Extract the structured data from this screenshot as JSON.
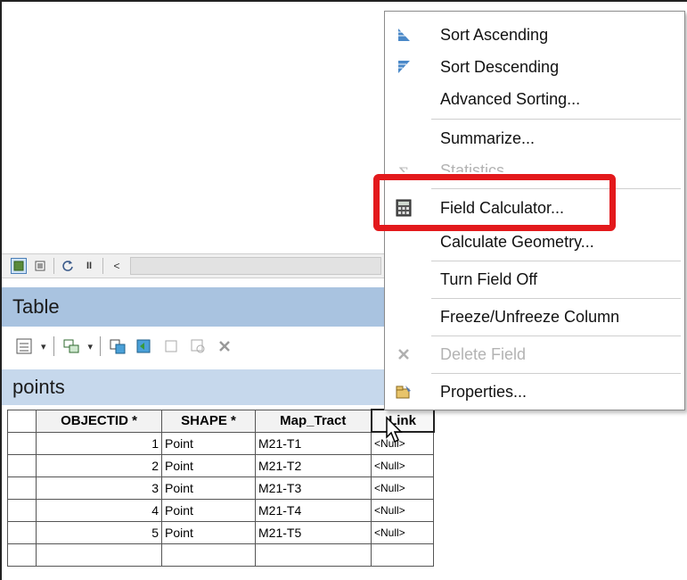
{
  "colors": {
    "highlight": "#e3191c",
    "table_header_bg": "#a9c3e0",
    "layer_bar_bg": "#c6d8ec"
  },
  "map_toolbar": {
    "icons": [
      "layout-view-icon",
      "data-view-icon",
      "refresh-icon",
      "pause-icon",
      "scroll-left-icon"
    ],
    "pause_glyph": "II",
    "left_glyph": "<"
  },
  "table_window": {
    "title": "Table",
    "toolbar_icons": [
      "table-options-icon",
      "related-tables-icon",
      "select-by-attributes-icon",
      "switch-selection-icon",
      "clear-selection-icon",
      "zoom-to-selected-icon",
      "delete-selected-icon"
    ],
    "layer_name": "points",
    "columns": [
      "OBJECTID *",
      "SHAPE *",
      "Map_Tract",
      "Link"
    ],
    "rows": [
      {
        "objectid": "1",
        "shape": "Point",
        "map_tract": "M21-T1",
        "link": "<Null>"
      },
      {
        "objectid": "2",
        "shape": "Point",
        "map_tract": "M21-T2",
        "link": "<Null>"
      },
      {
        "objectid": "3",
        "shape": "Point",
        "map_tract": "M21-T3",
        "link": "<Null>"
      },
      {
        "objectid": "4",
        "shape": "Point",
        "map_tract": "M21-T4",
        "link": "<Null>"
      },
      {
        "objectid": "5",
        "shape": "Point",
        "map_tract": "M21-T5",
        "link": "<Null>"
      }
    ]
  },
  "context_menu": {
    "items": [
      {
        "label": "Sort Ascending",
        "icon": "sort-ascending-icon",
        "enabled": true
      },
      {
        "label": "Sort Descending",
        "icon": "sort-descending-icon",
        "enabled": true
      },
      {
        "label": "Advanced Sorting...",
        "icon": "",
        "enabled": true
      },
      {
        "label": "Summarize...",
        "icon": "",
        "enabled": true
      },
      {
        "label": "Statistics...",
        "icon": "statistics-icon",
        "enabled": false
      },
      {
        "label": "Field Calculator...",
        "icon": "calculator-icon",
        "enabled": true
      },
      {
        "label": "Calculate Geometry...",
        "icon": "",
        "enabled": true
      },
      {
        "label": "Turn Field Off",
        "icon": "",
        "enabled": true
      },
      {
        "label": "Freeze/Unfreeze Column",
        "icon": "",
        "enabled": true
      },
      {
        "label": "Delete Field",
        "icon": "delete-field-icon",
        "enabled": false
      },
      {
        "label": "Properties...",
        "icon": "properties-icon",
        "enabled": true
      }
    ]
  }
}
